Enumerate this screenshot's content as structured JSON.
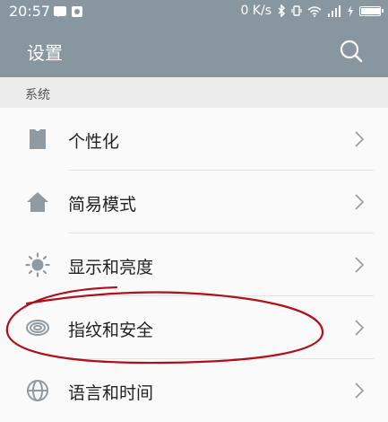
{
  "status_bar": {
    "time": "20:57",
    "data_rate": "0 K/s",
    "battery_level": 0.95
  },
  "header": {
    "title": "设置"
  },
  "section": {
    "label": "系统"
  },
  "items": [
    {
      "label": "个性化",
      "icon": "personalize-icon"
    },
    {
      "label": "简易模式",
      "icon": "home-icon"
    },
    {
      "label": "显示和亮度",
      "icon": "brightness-icon"
    },
    {
      "label": "指纹和安全",
      "icon": "fingerprint-icon"
    },
    {
      "label": "语言和时间",
      "icon": "globe-icon"
    }
  ],
  "colors": {
    "header_bg": "#87969f",
    "icon": "#8f9aa2",
    "annotation": "#b10f1a"
  }
}
